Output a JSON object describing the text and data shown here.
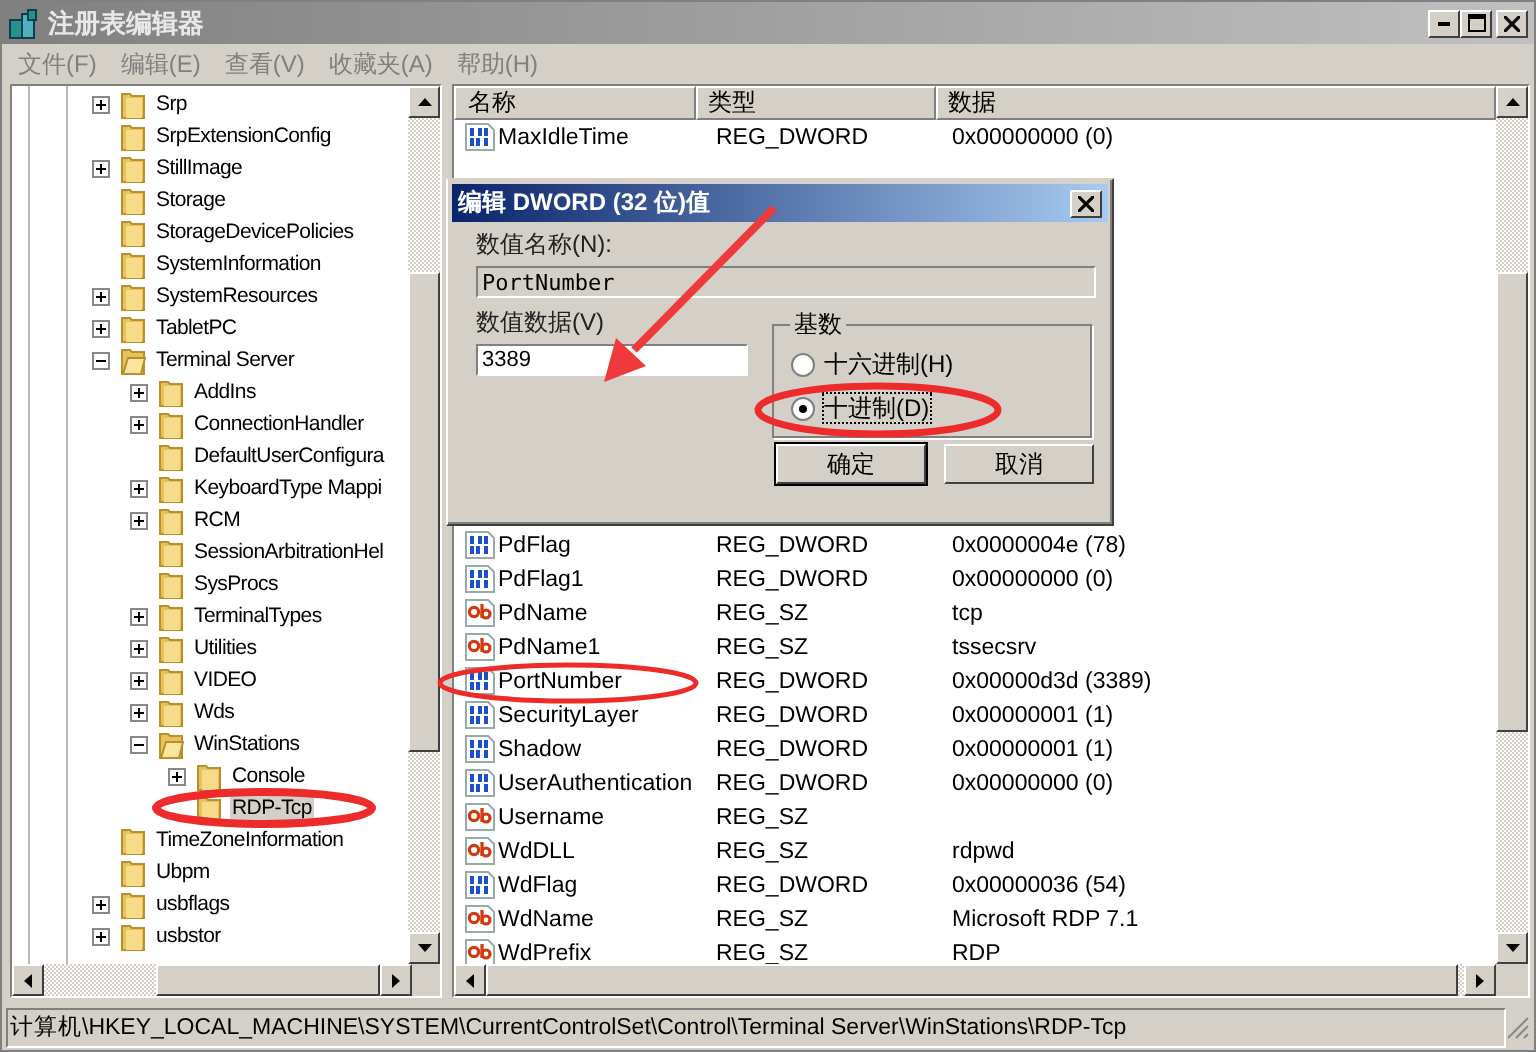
{
  "window": {
    "title": "注册表编辑器"
  },
  "menu": [
    "文件(F)",
    "编辑(E)",
    "查看(V)",
    "收藏夹(A)",
    "帮助(H)"
  ],
  "tree": [
    {
      "label": "Srp",
      "expandable": true,
      "expanded": false,
      "selected": false
    },
    {
      "label": "SrpExtensionConfig",
      "expandable": false,
      "expanded": false,
      "selected": false
    },
    {
      "label": "StillImage",
      "expandable": true,
      "expanded": false,
      "selected": false
    },
    {
      "label": "Storage",
      "expandable": false,
      "expanded": false,
      "selected": false
    },
    {
      "label": "StorageDevicePolicies",
      "expandable": false,
      "expanded": false,
      "selected": false
    },
    {
      "label": "SystemInformation",
      "expandable": false,
      "expanded": false,
      "selected": false
    },
    {
      "label": "SystemResources",
      "expandable": true,
      "expanded": false,
      "selected": false
    },
    {
      "label": "TabletPC",
      "expandable": true,
      "expanded": false,
      "selected": false
    },
    {
      "label": "Terminal Server",
      "expandable": true,
      "expanded": true,
      "selected": false,
      "children": [
        {
          "label": "AddIns",
          "expandable": true,
          "expanded": false,
          "selected": false
        },
        {
          "label": "ConnectionHandler",
          "expandable": true,
          "expanded": false,
          "selected": false
        },
        {
          "label": "DefaultUserConfigura",
          "expandable": false,
          "expanded": false,
          "selected": false
        },
        {
          "label": "KeyboardType Mappi",
          "expandable": true,
          "expanded": false,
          "selected": false
        },
        {
          "label": "RCM",
          "expandable": true,
          "expanded": false,
          "selected": false
        },
        {
          "label": "SessionArbitrationHel",
          "expandable": false,
          "expanded": false,
          "selected": false
        },
        {
          "label": "SysProcs",
          "expandable": false,
          "expanded": false,
          "selected": false
        },
        {
          "label": "TerminalTypes",
          "expandable": true,
          "expanded": false,
          "selected": false
        },
        {
          "label": "Utilities",
          "expandable": true,
          "expanded": false,
          "selected": false
        },
        {
          "label": "VIDEO",
          "expandable": true,
          "expanded": false,
          "selected": false
        },
        {
          "label": "Wds",
          "expandable": true,
          "expanded": false,
          "selected": false
        },
        {
          "label": "WinStations",
          "expandable": true,
          "expanded": true,
          "selected": false,
          "children": [
            {
              "label": "Console",
              "expandable": true,
              "expanded": false,
              "selected": false
            },
            {
              "label": "RDP-Tcp",
              "expandable": false,
              "expanded": false,
              "selected": true
            }
          ]
        }
      ]
    },
    {
      "label": "TimeZoneInformation",
      "expandable": false,
      "expanded": false,
      "selected": false
    },
    {
      "label": "Ubpm",
      "expandable": false,
      "expanded": false,
      "selected": false
    },
    {
      "label": "usbflags",
      "expandable": true,
      "expanded": false,
      "selected": false
    },
    {
      "label": "usbstor",
      "expandable": true,
      "expanded": false,
      "selected": false
    }
  ],
  "list": {
    "columns": [
      "名称",
      "类型",
      "数据"
    ],
    "rows_above": [
      {
        "kind": "dword",
        "name": "MaxIdleTime",
        "type": "REG_DWORD",
        "data": "0x00000000 (0)"
      }
    ],
    "rows": [
      {
        "kind": "dword",
        "name": "PdFlag",
        "type": "REG_DWORD",
        "data": "0x0000004e (78)"
      },
      {
        "kind": "dword",
        "name": "PdFlag1",
        "type": "REG_DWORD",
        "data": "0x00000000 (0)"
      },
      {
        "kind": "sz",
        "name": "PdName",
        "type": "REG_SZ",
        "data": "tcp"
      },
      {
        "kind": "sz",
        "name": "PdName1",
        "type": "REG_SZ",
        "data": "tssecsrv"
      },
      {
        "kind": "dword",
        "name": "PortNumber",
        "type": "REG_DWORD",
        "data": "0x00000d3d (3389)"
      },
      {
        "kind": "dword",
        "name": "SecurityLayer",
        "type": "REG_DWORD",
        "data": "0x00000001 (1)"
      },
      {
        "kind": "dword",
        "name": "Shadow",
        "type": "REG_DWORD",
        "data": "0x00000001 (1)"
      },
      {
        "kind": "dword",
        "name": "UserAuthentication",
        "type": "REG_DWORD",
        "data": "0x00000000 (0)"
      },
      {
        "kind": "sz",
        "name": "Username",
        "type": "REG_SZ"
      },
      {
        "kind": "sz",
        "name": "WdDLL",
        "type": "REG_SZ",
        "data": "rdpwd"
      },
      {
        "kind": "dword",
        "name": "WdFlag",
        "type": "REG_DWORD",
        "data": "0x00000036 (54)"
      },
      {
        "kind": "sz",
        "name": "WdName",
        "type": "REG_SZ",
        "data": "Microsoft RDP 7.1"
      },
      {
        "kind": "sz",
        "name": "WdPrefix",
        "type": "REG_SZ",
        "data": "RDP"
      }
    ]
  },
  "dialog": {
    "title": "编辑 DWORD (32 位)值",
    "name_label": "数值名称(N):",
    "name_value": "PortNumber",
    "data_label": "数值数据(V)",
    "data_value": "3389",
    "base_group": "基数",
    "radios": [
      {
        "label": "十六进制(H)",
        "selected": false
      },
      {
        "label": "十进制(D)",
        "selected": true
      }
    ],
    "buttons": [
      {
        "label": "确定",
        "default": true
      },
      {
        "label": "取消",
        "default": false
      }
    ]
  },
  "status_bar": "计算机\\HKEY_LOCAL_MACHINE\\SYSTEM\\CurrentControlSet\\Control\\Terminal Server\\WinStations\\RDP-Tcp"
}
